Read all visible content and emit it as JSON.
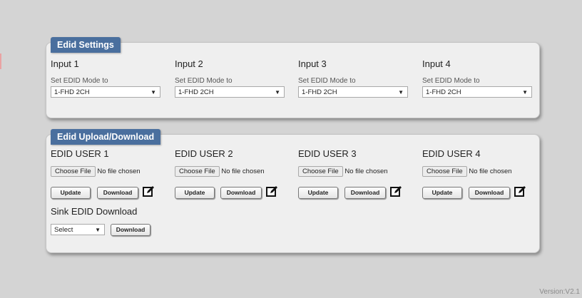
{
  "edid_settings": {
    "title": "Edid Settings",
    "inputs": [
      {
        "label": "Input 1",
        "mode_label": "Set EDID Mode to",
        "mode_value": "1-FHD 2CH"
      },
      {
        "label": "Input 2",
        "mode_label": "Set EDID Mode to",
        "mode_value": "1-FHD 2CH"
      },
      {
        "label": "Input 3",
        "mode_label": "Set EDID Mode to",
        "mode_value": "1-FHD 2CH"
      },
      {
        "label": "Input 4",
        "mode_label": "Set EDID Mode to",
        "mode_value": "1-FHD 2CH"
      }
    ]
  },
  "edid_upload": {
    "title": "Edid Upload/Download",
    "users": [
      {
        "label": "EDID USER 1",
        "choose_label": "Choose File",
        "file_status": "No file chosen",
        "update_label": "Update",
        "download_label": "Download"
      },
      {
        "label": "EDID USER 2",
        "choose_label": "Choose File",
        "file_status": "No file chosen",
        "update_label": "Update",
        "download_label": "Download"
      },
      {
        "label": "EDID USER 3",
        "choose_label": "Choose File",
        "file_status": "No file chosen",
        "update_label": "Update",
        "download_label": "Download"
      },
      {
        "label": "EDID USER 4",
        "choose_label": "Choose File",
        "file_status": "No file chosen",
        "update_label": "Update",
        "download_label": "Download"
      }
    ],
    "sink": {
      "label": "Sink EDID Download",
      "select_value": "Select",
      "download_label": "Download"
    }
  },
  "icons": {
    "edit": "edit-icon",
    "dropdown": "chevron-down-icon"
  },
  "colors": {
    "tab_bg": "#4a6f9e",
    "panel_bg": "#efefef",
    "page_bg": "#d4d4d4"
  },
  "version": "Version:V2.1"
}
